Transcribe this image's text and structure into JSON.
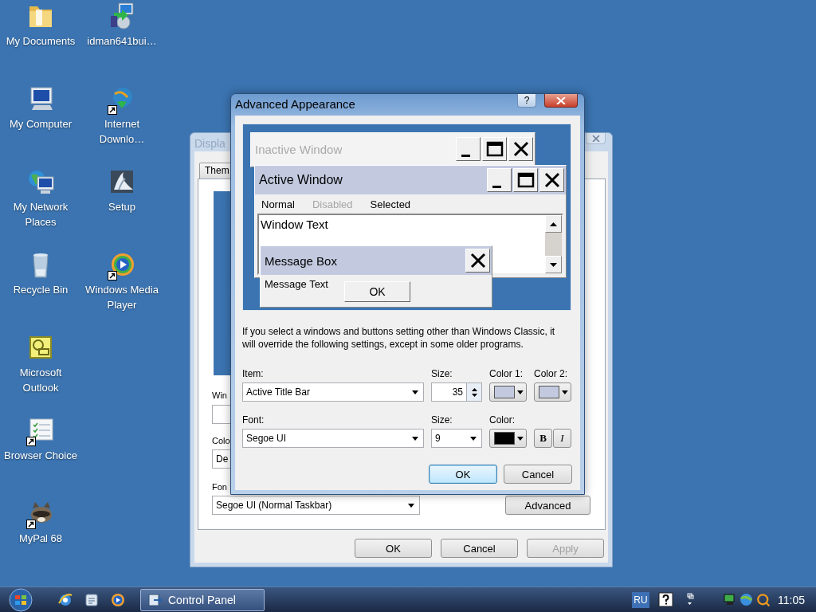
{
  "desktop_icons": [
    {
      "label": "My Documents",
      "shortcut": false
    },
    {
      "label": "My Computer",
      "shortcut": false
    },
    {
      "label": "My Network Places",
      "shortcut": false
    },
    {
      "label": "Recycle Bin",
      "shortcut": false
    },
    {
      "label": "Microsoft Outlook",
      "shortcut": false
    },
    {
      "label": "Browser Choice",
      "shortcut": true
    },
    {
      "label": "MyPal 68",
      "shortcut": true
    },
    {
      "label": "idman641bui…",
      "shortcut": false
    },
    {
      "label": "Internet Downlo…",
      "shortcut": true
    },
    {
      "label": "Setup",
      "shortcut": false
    },
    {
      "label": "Windows Media Player",
      "shortcut": true
    }
  ],
  "display_window": {
    "title": "Displa",
    "tab": "Them",
    "window_label": "Win",
    "color_label": "Colo",
    "color_value": "De",
    "font_label": "Fon",
    "font_value": "Segoe UI (Normal Taskbar)",
    "advanced_button": "Advanced",
    "buttons": [
      {
        "label": "OK",
        "disabled": false
      },
      {
        "label": "Cancel",
        "disabled": false
      },
      {
        "label": "Apply",
        "disabled": true
      }
    ]
  },
  "advanced_dialog": {
    "title": "Advanced Appearance",
    "help_button": "?",
    "preview": {
      "inactive_title": "Inactive Window",
      "active_title": "Active Window",
      "menu": [
        {
          "label": "Normal",
          "disabled": false
        },
        {
          "label": "Disabled",
          "disabled": true
        },
        {
          "label": "Selected",
          "disabled": false
        }
      ],
      "window_text": "Window Text",
      "message_title": "Message Box",
      "message_text": "Message Text",
      "message_button": "OK"
    },
    "note": "If you select a windows and buttons setting other than Windows Classic, it will override the following settings, except in some older programs.",
    "item": {
      "label": "Item:",
      "value": "Active Title Bar"
    },
    "item_size": {
      "label": "Size:",
      "value": "35"
    },
    "color_1": {
      "label": "Color 1:",
      "color": "#c3cae0"
    },
    "color_2": {
      "label": "Color 2:",
      "color": "#c3cae0"
    },
    "font": {
      "label": "Font:",
      "value": "Segoe UI"
    },
    "font_size": {
      "label": "Size:",
      "value": "9"
    },
    "font_color": {
      "label": "Color:",
      "color": "#000000"
    },
    "bold_button": "B",
    "italic_button": "I",
    "buttons": [
      {
        "label": "OK",
        "default": true
      },
      {
        "label": "Cancel",
        "default": false
      }
    ]
  },
  "taskbar": {
    "tasks": [
      {
        "label": "Control Panel",
        "selected": true
      }
    ],
    "language": "RU",
    "clock": "11:05"
  }
}
